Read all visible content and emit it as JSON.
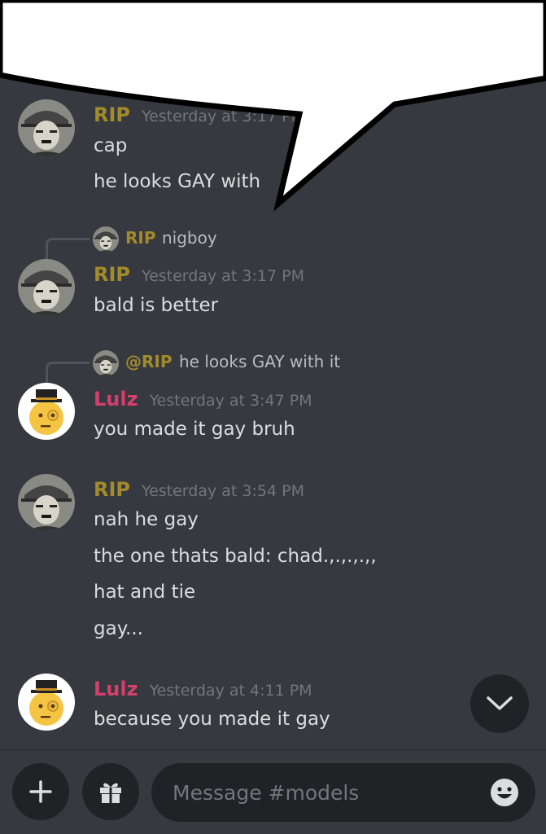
{
  "channel": {
    "input_placeholder": "Message #models"
  },
  "messages": [
    {
      "author": "RIP",
      "timestamp": "Yesterday at 3:17 PM",
      "lines": [
        "cap",
        "he looks GAY with"
      ]
    },
    {
      "reply_to": {
        "author": "RIP",
        "text": "nigboy"
      },
      "author": "RIP",
      "timestamp": "Yesterday at 3:17 PM",
      "lines": [
        "bald is better"
      ]
    },
    {
      "reply_to": {
        "author": "@RIP",
        "text": "he looks GAY with it"
      },
      "author": "Lulz",
      "timestamp": "Yesterday at 3:47 PM",
      "lines": [
        "you made it gay bruh"
      ]
    },
    {
      "author": "RIP",
      "timestamp": "Yesterday at 3:54 PM",
      "lines": [
        "nah he gay",
        "the one thats bald: chad.,.,.,.,,",
        "hat and tie",
        "gay..."
      ]
    },
    {
      "author": "Lulz",
      "timestamp": "Yesterday at 4:11 PM",
      "lines": [
        "because you made it gay"
      ]
    }
  ],
  "colors": {
    "background": "#36393f",
    "rip_name": "#a28b2a",
    "lulz_name": "#d4406c",
    "timestamp": "#72767d",
    "input_bg": "#202225"
  },
  "icons": {
    "add": "plus-icon",
    "gift": "gift-icon",
    "emoji": "smile-icon",
    "scroll": "chevron-down-icon"
  }
}
